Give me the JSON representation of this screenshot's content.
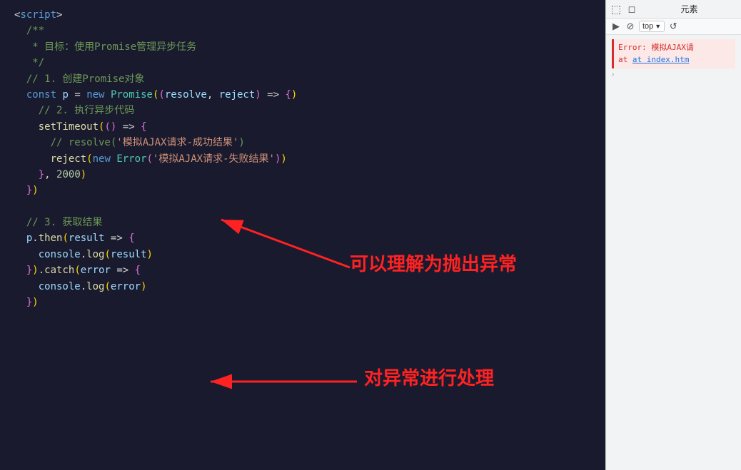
{
  "editor": {
    "lines": [
      {
        "id": 1,
        "content": "<script>"
      },
      {
        "id": 2,
        "content": "  /**"
      },
      {
        "id": 3,
        "content": "   * 目标：使用Promise管理异步任务"
      },
      {
        "id": 4,
        "content": "   */"
      },
      {
        "id": 5,
        "content": "  // 1. 创建Promise对象"
      },
      {
        "id": 6,
        "content": "  const p = new Promise((resolve, reject) => {"
      },
      {
        "id": 7,
        "content": "    // 2. 执行异步代码"
      },
      {
        "id": 8,
        "content": "    setTimeout(() => {"
      },
      {
        "id": 9,
        "content": "      // resolve('模拟AJAX请求-成功结果')"
      },
      {
        "id": 10,
        "content": "      reject(new Error('模拟AJAX请求-失败结果'))"
      },
      {
        "id": 11,
        "content": "    }, 2000)"
      },
      {
        "id": 12,
        "content": "  })"
      },
      {
        "id": 13,
        "content": ""
      },
      {
        "id": 14,
        "content": "  // 3. 获取结果"
      },
      {
        "id": 15,
        "content": "  p.then(result => {"
      },
      {
        "id": 16,
        "content": "    console.log(result)"
      },
      {
        "id": 17,
        "content": "  }).catch(error => {"
      },
      {
        "id": 18,
        "content": "    console.log(error)"
      },
      {
        "id": 19,
        "content": "  })"
      }
    ],
    "annotation1": "可以理解为抛出异常",
    "annotation2": "对异常进行处理"
  },
  "devtools": {
    "tabs": [
      "元素"
    ],
    "console_toolbar": {
      "top_label": "top",
      "chevron": "▼"
    },
    "console_content": {
      "error_text": "Error: 模拟AJAX请",
      "error_location": "at index.htm",
      "expand_arrow": "›"
    }
  },
  "icons": {
    "cursor_select": "⬚",
    "inspect": "◻",
    "stop": "⊘",
    "refresh": "↺"
  }
}
